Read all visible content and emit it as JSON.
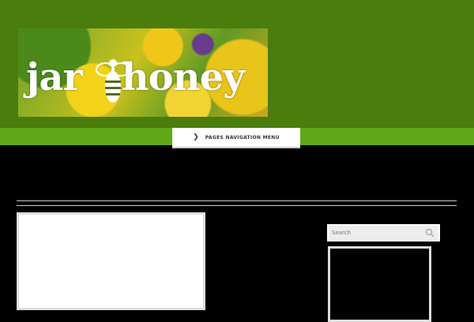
{
  "header": {
    "logo_text_left": "jar",
    "logo_text_right": "honey"
  },
  "nav": {
    "menu_label": "PAGES NAVIGATION MENU"
  },
  "site": {
    "title": "",
    "description": ""
  },
  "sidebar": {
    "search_placeholder": "Search"
  },
  "colors": {
    "header_bg": "#4a7d0c",
    "nav_bar": "#5fa818",
    "page_bg": "#000000"
  },
  "icons": {
    "nav_chevron": "chevron-down-icon",
    "search": "search-icon",
    "logo_bee": "bee-icon"
  }
}
